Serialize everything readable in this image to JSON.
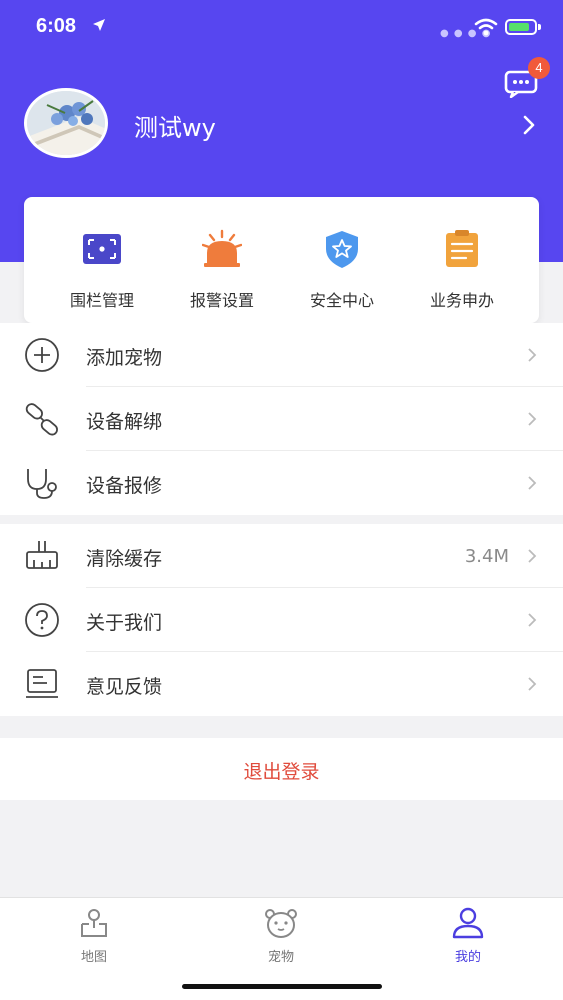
{
  "status_bar": {
    "time": "6:08"
  },
  "profile": {
    "username": "测试wy",
    "message_badge": "4"
  },
  "quick_actions": [
    {
      "label": "围栏管理",
      "icon": "fence-icon"
    },
    {
      "label": "报警设置",
      "icon": "alarm-icon"
    },
    {
      "label": "安全中心",
      "icon": "shield-icon"
    },
    {
      "label": "业务申办",
      "icon": "clipboard-icon"
    }
  ],
  "menu_group1": [
    {
      "label": "添加宠物",
      "icon": "add-circle-icon"
    },
    {
      "label": "设备解绑",
      "icon": "unlink-icon"
    },
    {
      "label": "设备报修",
      "icon": "stethoscope-icon"
    }
  ],
  "menu_group2": [
    {
      "label": "清除缓存",
      "icon": "broom-icon",
      "value": "3.4M"
    },
    {
      "label": "关于我们",
      "icon": "question-icon"
    },
    {
      "label": "意见反馈",
      "icon": "feedback-icon"
    }
  ],
  "logout": {
    "label": "退出登录"
  },
  "tabs": [
    {
      "label": "地图",
      "icon": "map-icon",
      "active": false
    },
    {
      "label": "宠物",
      "icon": "pet-icon",
      "active": false
    },
    {
      "label": "我的",
      "icon": "user-icon",
      "active": true
    }
  ],
  "colors": {
    "header": "#5746f0",
    "accent": "#4b3ee0",
    "logout": "#e04b3c",
    "badge": "#f15a3a"
  }
}
